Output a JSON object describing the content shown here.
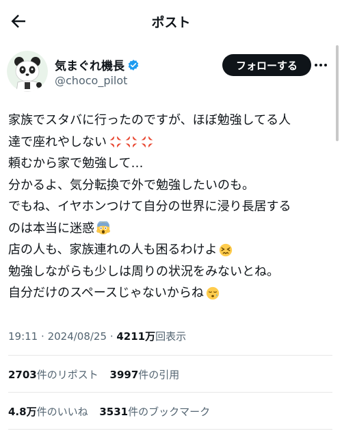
{
  "header": {
    "title": "ポスト"
  },
  "author": {
    "name": "気まぐれ機長",
    "handle": "@choco_pilot",
    "follow_label": "フォローする"
  },
  "tweet": {
    "lines": [
      {
        "text": "家族でスタバに行ったのですが、ほぼ勉強してる人",
        "emojis": []
      },
      {
        "text": "達で座れやしない",
        "emojis": [
          "anger",
          "anger",
          "anger"
        ]
      },
      {
        "text": "頼むから家で勉強して…",
        "emojis": []
      },
      {
        "text": "分かるよ、気分転換で外で勉強したいのも。",
        "emojis": []
      },
      {
        "text": "でもね、イヤホンつけて自分の世界に浸り長居する",
        "emojis": []
      },
      {
        "text": "のは本当に迷惑",
        "emojis": [
          "scream"
        ]
      },
      {
        "text": "店の人も、家族連れの人も困るわけよ",
        "emojis": [
          "confounded"
        ]
      },
      {
        "text": "勉強しながらも少しは周りの状況をみないとね。",
        "emojis": []
      },
      {
        "text": "自分だけのスペースじゃないからね",
        "emojis": [
          "sad"
        ]
      }
    ]
  },
  "meta": {
    "time": "19:11",
    "date": "2024/08/25",
    "views_count": "4211万",
    "views_label": "回表示"
  },
  "stats": {
    "reposts_count": "2703",
    "reposts_label": "件のリポスト",
    "quotes_count": "3997",
    "quotes_label": "件の引用",
    "likes_count": "4.8万",
    "likes_label": "件のいいね",
    "bookmarks_count": "3531",
    "bookmarks_label": "件のブックマーク"
  },
  "colors": {
    "text": "#0f1419",
    "secondary": "#536471",
    "verified": "#1d9bf0",
    "follow_bg": "#0f1419"
  }
}
